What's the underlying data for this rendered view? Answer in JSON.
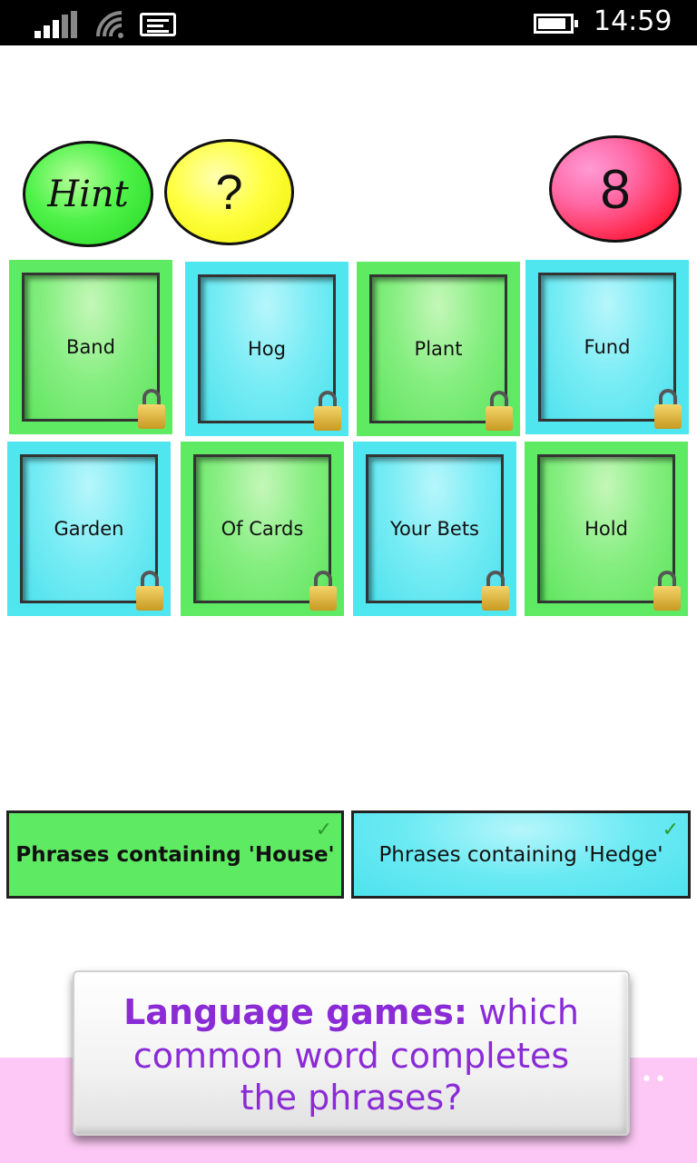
{
  "status_bar": {
    "time": "14:59",
    "icons": [
      "signal-icon",
      "wifi-icon",
      "message-icon",
      "battery-icon"
    ]
  },
  "top": {
    "hint_label": "Hint",
    "help_label": "?",
    "counter_value": "8"
  },
  "tiles": [
    {
      "label": "Band",
      "color": "green",
      "locked": true
    },
    {
      "label": "Hog",
      "color": "blue",
      "locked": true
    },
    {
      "label": "Plant",
      "color": "green",
      "locked": true
    },
    {
      "label": "Fund",
      "color": "blue",
      "locked": true
    },
    {
      "label": "Garden",
      "color": "blue",
      "locked": true
    },
    {
      "label": "Of Cards",
      "color": "green",
      "locked": true
    },
    {
      "label": "Your Bets",
      "color": "blue",
      "locked": true
    },
    {
      "label": "Hold",
      "color": "green",
      "locked": true
    }
  ],
  "categories": [
    {
      "label": "Phrases containing 'House'",
      "color": "green",
      "solved": true
    },
    {
      "label": "Phrases containing 'Hedge'",
      "color": "blue",
      "solved": true
    }
  ],
  "caption": {
    "bold": "Language games:",
    "line1_rest": " which",
    "line2": "common word completes",
    "line3": "the phrases?"
  },
  "more_dots": "••",
  "colors": {
    "green": "#5fea63",
    "blue": "#50e6ef",
    "caption_text": "#8a2bd6",
    "pink_band": "#fdc8f5"
  }
}
